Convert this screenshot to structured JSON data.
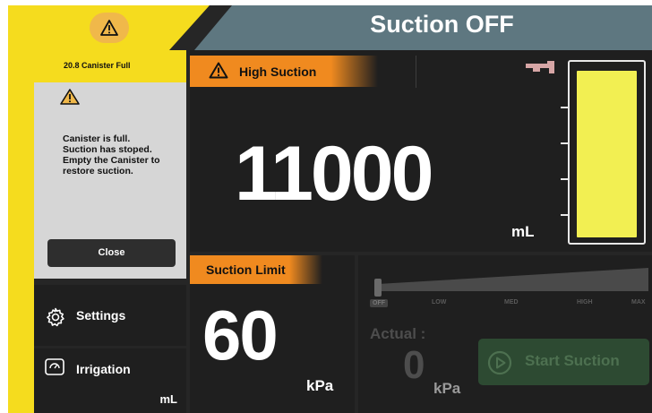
{
  "header": {
    "title": "Suction OFF",
    "warning_icon": "warning-triangle-icon",
    "colors": {
      "yellow": "#f5dc1e",
      "teal": "#5e7780",
      "warning": "#f0b84a"
    }
  },
  "alert": {
    "title": "20.8 Canister Full",
    "icon": "warning-triangle-icon",
    "message": "Canister is full.\nSuction has stoped.\nEmpty the Canister to\nrestore suction.",
    "close_label": "Close"
  },
  "menu": {
    "settings_label": "Settings",
    "settings_icon": "gear-icon",
    "irrigation_label": "Irrigation",
    "irrigation_icon": "irrigation-gauge-icon",
    "irrigation_unit": "mL"
  },
  "volume": {
    "alarm_label": "High Suction",
    "value": "11000",
    "unit": "mL",
    "canister_fill_fraction": 0.97,
    "canister_icon": "canister-pump-icon"
  },
  "limit": {
    "label": "Suction Limit",
    "value": "60",
    "unit": "kPa"
  },
  "control": {
    "levels": [
      "OFF",
      "LOW",
      "MED",
      "HIGH",
      "MAX"
    ],
    "selected_level": "OFF",
    "actual_label": "Actual :",
    "actual_value": "0",
    "actual_unit": "kPa",
    "start_label": "Start Suction",
    "start_icon": "play-circle-icon",
    "start_enabled": false
  },
  "accent_colors": {
    "orange": "#f08a1f",
    "canister_fill": "#f2ef52",
    "start_disabled": "#2d4a32"
  }
}
